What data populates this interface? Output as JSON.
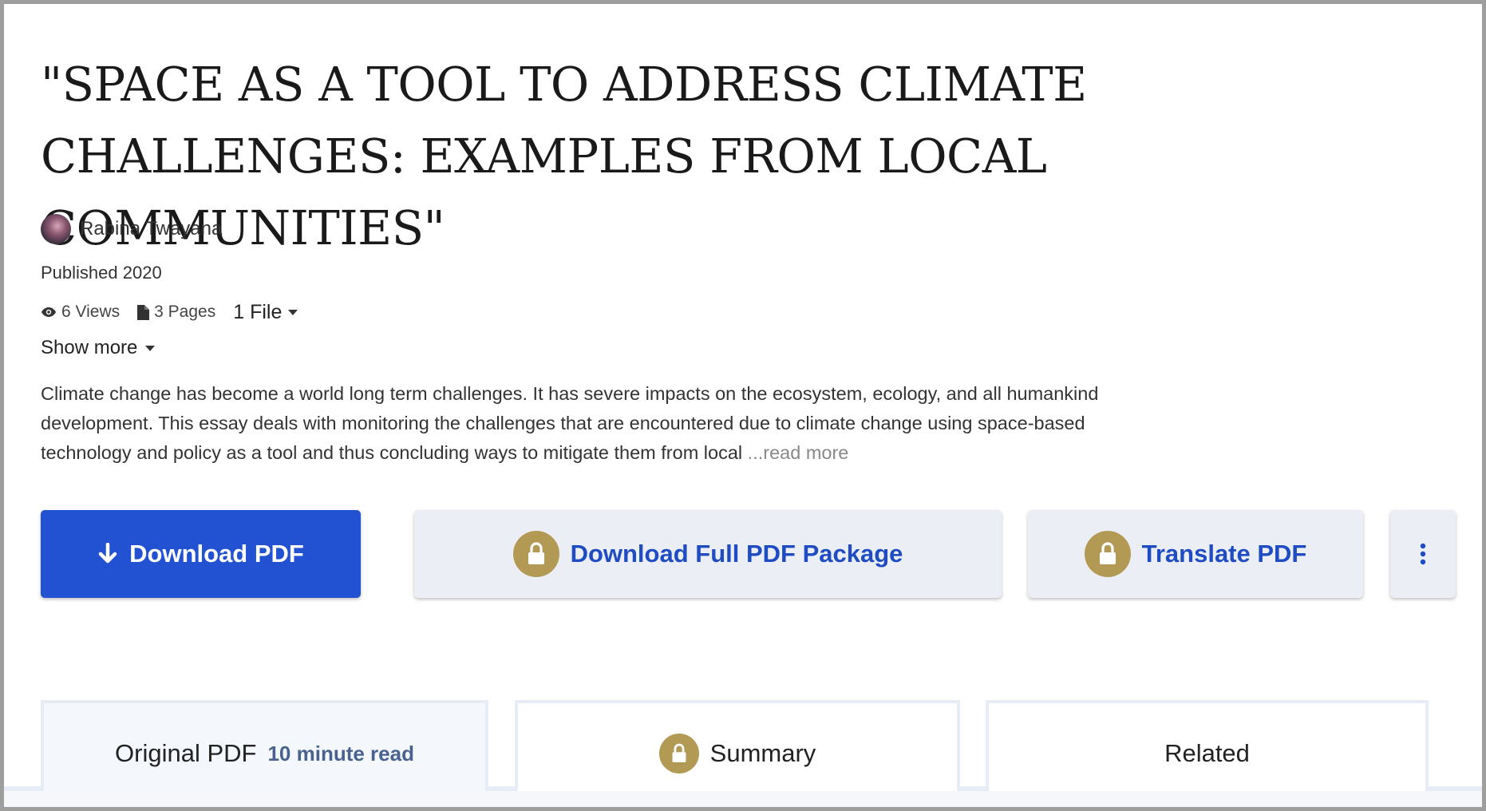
{
  "paper": {
    "title": "\"SPACE AS A TOOL TO ADDRESS CLIMATE CHALLENGES: EXAMPLES FROM LOCAL COMMUNITIES\"",
    "author": "Rabina Twayana",
    "published": "Published 2020",
    "views": "6 Views",
    "pages": "3 Pages",
    "files": "1 File",
    "show_more": "Show more",
    "abstract": "Climate change has become a world long term challenges. It has severe impacts on the ecosystem, ecology, and all humankind development. This essay deals with monitoring the challenges that are encountered due to climate change using space-based technology and policy as a tool and thus concluding ways to mitigate them from local",
    "read_more": "...read more"
  },
  "actions": {
    "download_pdf": "Download PDF",
    "download_package": "Download Full PDF Package",
    "translate_pdf": "Translate PDF"
  },
  "tabs": [
    {
      "label": "Original PDF",
      "sub": "10 minute read"
    },
    {
      "label": "Summary"
    },
    {
      "label": "Related"
    }
  ],
  "colors": {
    "primary": "#2251d1",
    "secondary_bg": "#eceef5",
    "link_blue": "#1f4cc3",
    "lock_gold": "#b39a54"
  },
  "icons": [
    "eye-icon",
    "file-icon",
    "caret-down-icon",
    "arrow-down-icon",
    "lock-icon",
    "more-vertical-icon"
  ]
}
